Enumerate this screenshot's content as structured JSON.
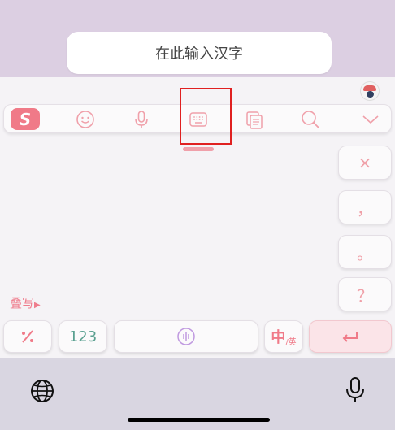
{
  "input": {
    "placeholder": "在此输入汉字"
  },
  "toolbar": {
    "logo_letter": "S",
    "items": [
      "sogou-logo-icon",
      "emoji-icon",
      "microphone-icon",
      "keyboard-icon",
      "clipboard-icon",
      "search-icon",
      "collapse-icon"
    ]
  },
  "side_keys": {
    "delete": "×",
    "comma": "，",
    "period": "。",
    "question": "？"
  },
  "handwriting": {
    "label": "叠写"
  },
  "bottom_row": {
    "symbol": "⁄",
    "numbers": "123",
    "lang_main": "中",
    "lang_sub": "/英"
  },
  "colors": {
    "accent": "#f07a88",
    "top_bg": "#dccfe2",
    "highlight": "#e02020"
  }
}
